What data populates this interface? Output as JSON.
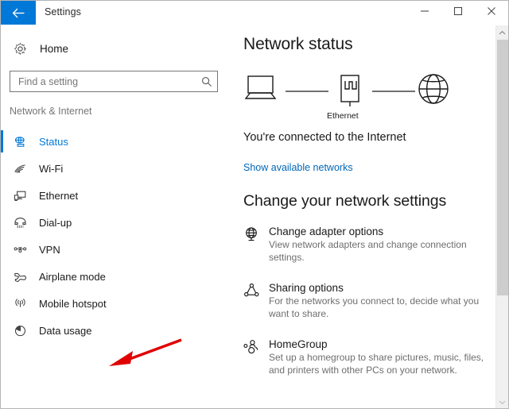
{
  "window": {
    "title": "Settings",
    "back_icon": "arrow-left-icon",
    "accent_color": "#0078d7",
    "controls": {
      "minimize": "minimize-icon",
      "maximize": "maximize-icon",
      "close": "close-icon"
    }
  },
  "sidebar": {
    "home": {
      "label": "Home",
      "icon": "gear-icon"
    },
    "search": {
      "placeholder": "Find a setting",
      "value": "",
      "icon": "search-icon"
    },
    "category": "Network & Internet",
    "items": [
      {
        "label": "Status",
        "icon": "network-status-icon",
        "selected": true
      },
      {
        "label": "Wi-Fi",
        "icon": "wifi-icon",
        "selected": false
      },
      {
        "label": "Ethernet",
        "icon": "ethernet-icon",
        "selected": false
      },
      {
        "label": "Dial-up",
        "icon": "dialup-phone-icon",
        "selected": false
      },
      {
        "label": "VPN",
        "icon": "vpn-icon",
        "selected": false
      },
      {
        "label": "Airplane mode",
        "icon": "airplane-icon",
        "selected": false
      },
      {
        "label": "Mobile hotspot",
        "icon": "hotspot-icon",
        "selected": false
      },
      {
        "label": "Data usage",
        "icon": "pie-chart-icon",
        "selected": false
      }
    ]
  },
  "main": {
    "title": "Network status",
    "diagram": {
      "device_icon": "laptop-icon",
      "adapter_icon": "ethernet-port-icon",
      "internet_icon": "globe-icon",
      "adapter_caption": "Ethernet"
    },
    "status_text": "You're connected to the Internet",
    "link": {
      "label": "Show available networks",
      "color": "#0067b8"
    },
    "section_title": "Change your network settings",
    "settings": [
      {
        "icon": "globe-adapter-icon",
        "title": "Change adapter options",
        "desc": "View network adapters and change connection settings."
      },
      {
        "icon": "sharing-nodes-icon",
        "title": "Sharing options",
        "desc": "For the networks you connect to, decide what you want to share."
      },
      {
        "icon": "homegroup-icon",
        "title": "HomeGroup",
        "desc": "Set up a homegroup to share pictures, music, files, and printers with other PCs on your network."
      }
    ]
  },
  "scrollbar": {
    "up_icon": "chevron-up-icon",
    "down_icon": "chevron-down-icon"
  },
  "annotation": {
    "arrow_color": "#e00000",
    "points_at": "Mobile hotspot"
  }
}
